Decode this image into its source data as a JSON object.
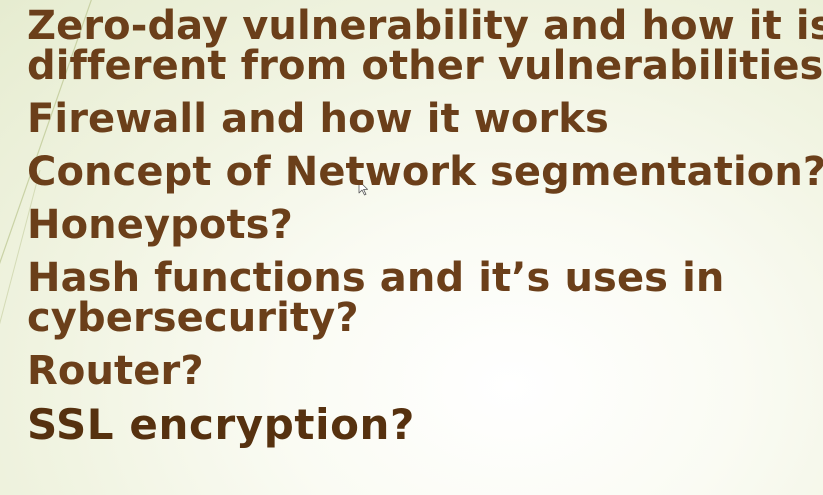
{
  "slide": {
    "background_color": "#f1f4e2",
    "text_color": "#6b3f1a",
    "bullets": [
      {
        "lines": [
          "Zero-day vulnerability and how it is",
          "different from other vulnerabilities"
        ]
      },
      {
        "lines": [
          "Firewall and how it works"
        ]
      },
      {
        "lines": [
          "Concept of Network segmentation?"
        ]
      },
      {
        "lines": [
          "Honeypots?"
        ]
      },
      {
        "lines": [
          "Hash functions and it’s uses in",
          "cybersecurity?"
        ]
      },
      {
        "lines": [
          "Router?"
        ]
      },
      {
        "lines": [
          "SSL encryption?"
        ]
      }
    ]
  },
  "decorations": {
    "icons": [
      "diagonal-accent-line-icon",
      "mouse-cursor-icon"
    ]
  }
}
